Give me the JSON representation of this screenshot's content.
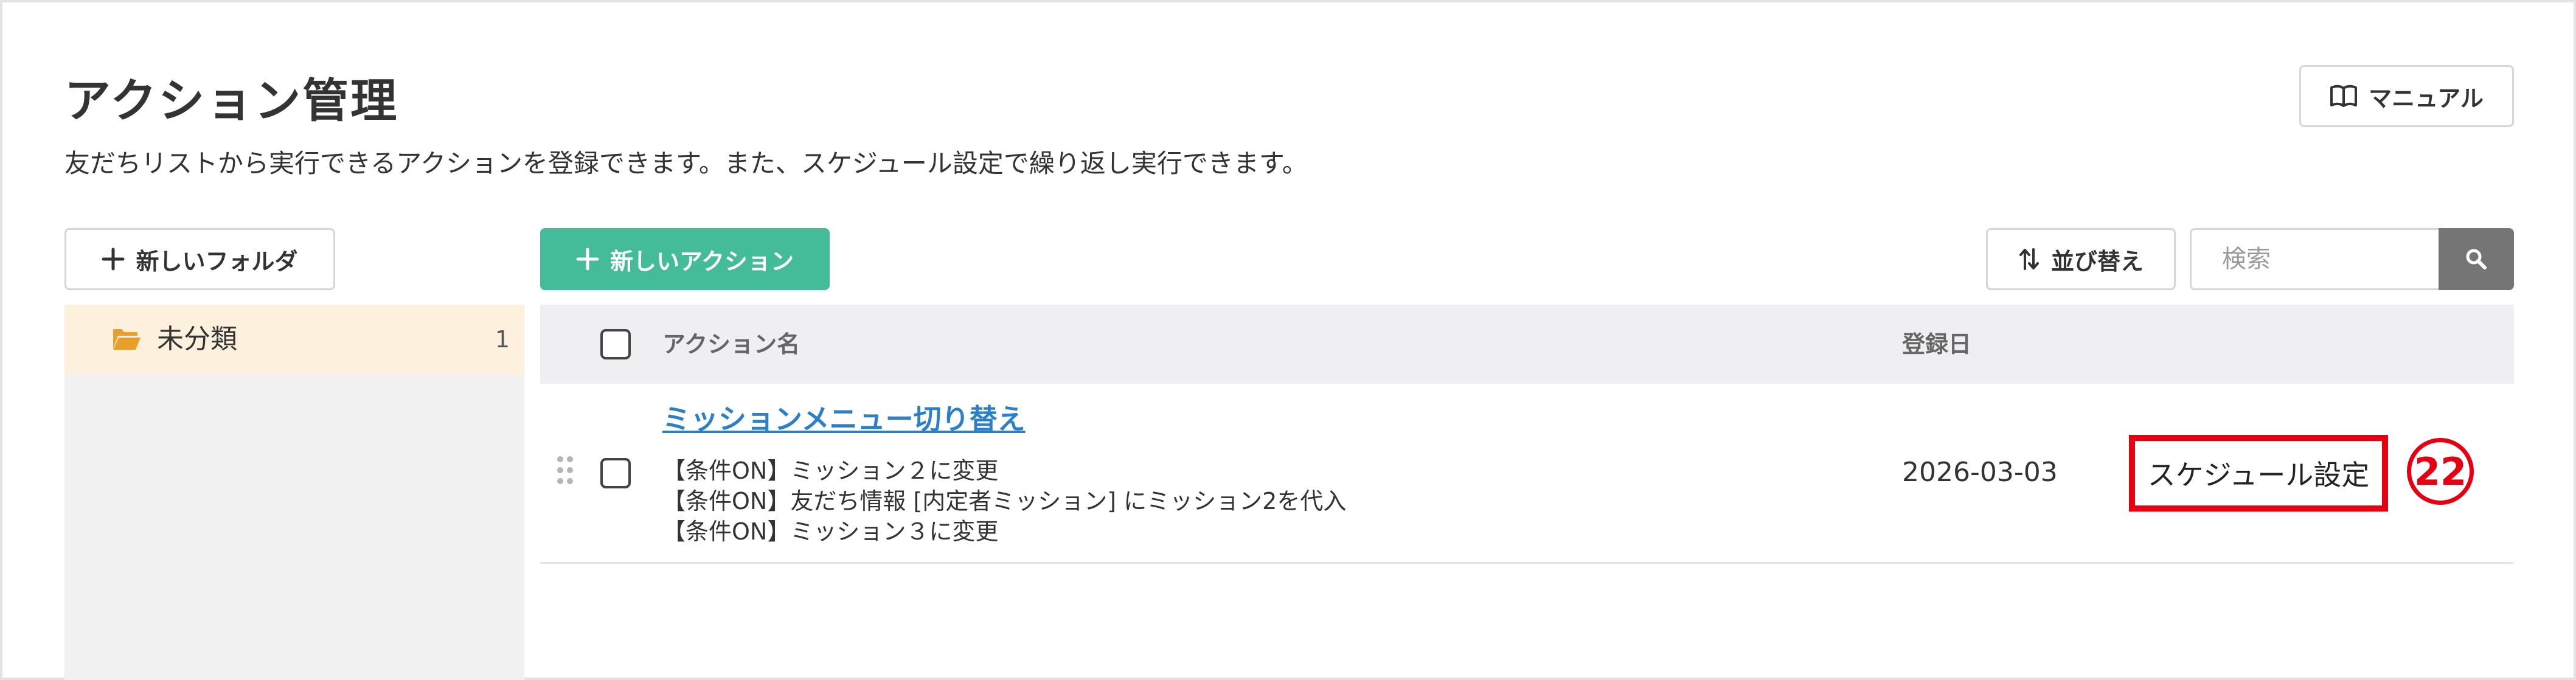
{
  "header": {
    "title": "アクション管理",
    "description": "友だちリストから実行できるアクションを登録できます。また、スケジュール設定で繰り返し実行できます。",
    "manual_label": "マニュアル"
  },
  "toolbar": {
    "new_folder_label": "新しいフォルダ",
    "new_action_label": "新しいアクション",
    "sort_label": "並び替え",
    "search_placeholder": "検索"
  },
  "sidebar": {
    "folders": [
      {
        "label": "未分類",
        "count": "1"
      }
    ]
  },
  "table": {
    "columns": {
      "name": "アクション名",
      "date": "登録日"
    },
    "rows": [
      {
        "name": "ミッションメニュー切り替え",
        "details": [
          "【条件ON】ミッション２に変更",
          "【条件ON】友だち情報 [内定者ミッション] にミッション2を代入",
          "【条件ON】ミッション３に変更"
        ],
        "date": "2026-03-03",
        "schedule_label": "スケジュール設定"
      }
    ]
  },
  "annotation": {
    "marker": "22",
    "color": "#e60012"
  },
  "colors": {
    "primary": "#45bc99",
    "link": "#2d7fc8",
    "sidebar_active": "#fdf1de",
    "folder_icon": "#e9a02a",
    "header_bg": "#efeff1",
    "search_button": "#757575"
  }
}
